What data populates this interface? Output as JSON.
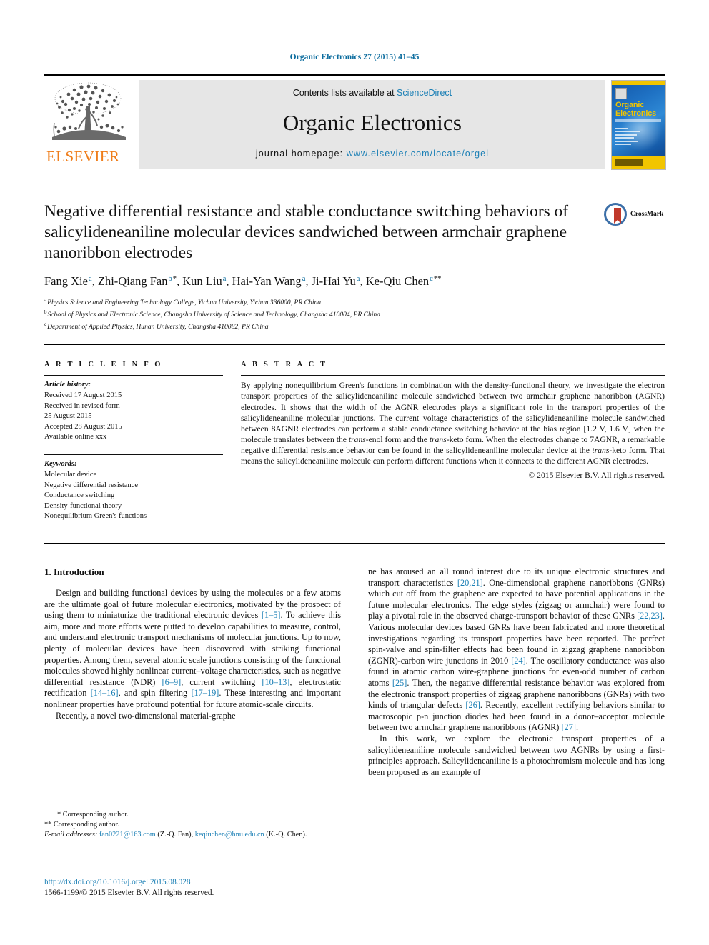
{
  "running_head": "Organic Electronics 27 (2015) 41–45",
  "masthead": {
    "publisher": "ELSEVIER",
    "contents_prefix": "Contents lists available at ",
    "contents_link": "ScienceDirect",
    "journal_name": "Organic Electronics",
    "homepage_label": "journal homepage: ",
    "homepage_url": "www.elsevier.com/locate/orgel",
    "cover_title": "Organic Electronics",
    "accent_blue": "#1a7fb5",
    "accent_orange": "#ef7d1a",
    "cover_yellow": "#f2c500"
  },
  "crossmark": {
    "label": "CrossMark"
  },
  "title": "Negative differential resistance and stable conductance switching behaviors of salicylideneaniline molecular devices sandwiched between armchair graphene nanoribbon electrodes",
  "authors": [
    {
      "name": "Fang Xie",
      "sup": "a",
      "star": ""
    },
    {
      "name": "Zhi-Qiang Fan",
      "sup": "b",
      "star": "*"
    },
    {
      "name": "Kun Liu",
      "sup": "a",
      "star": ""
    },
    {
      "name": "Hai-Yan Wang",
      "sup": "a",
      "star": ""
    },
    {
      "name": "Ji-Hai Yu",
      "sup": "a",
      "star": ""
    },
    {
      "name": "Ke-Qiu Chen",
      "sup": "c",
      "star": "**"
    }
  ],
  "affiliations": [
    {
      "mark": "a",
      "text": "Physics Science and Engineering Technology College, Yichun University, Yichun 336000, PR China"
    },
    {
      "mark": "b",
      "text": "School of Physics and Electronic Science, Changsha University of Science and Technology, Changsha 410004, PR China"
    },
    {
      "mark": "c",
      "text": "Department of Applied Physics, Hunan University, Changsha 410082, PR China"
    }
  ],
  "article_info": {
    "heading": "A R T I C L E    I N F O",
    "history_label": "Article history:",
    "history": [
      "Received 17 August 2015",
      "Received in revised form",
      "25 August 2015",
      "Accepted 28 August 2015",
      "Available online xxx"
    ],
    "keywords_label": "Keywords:",
    "keywords": [
      "Molecular device",
      "Negative differential resistance",
      "Conductance switching",
      "Density-functional theory",
      "Nonequilibrium Green's functions"
    ]
  },
  "abstract": {
    "heading": "A B S T R A C T",
    "body_part1": "By applying nonequilibrium Green's functions in combination with the density-functional theory, we investigate the electron transport properties of the salicylideneaniline molecule sandwiched between two armchair graphene nanoribbon (AGNR) electrodes. It shows that the width of the AGNR electrodes plays a significant role in the transport properties of the salicylideneaniline molecular junctions. The current–voltage characteristics of the salicylideneaniline molecule sandwiched between 8AGNR electrodes can perform a stable conductance switching behavior at the bias region [1.2 V, 1.6 V] when the molecule translates between the ",
    "italic1": "trans",
    "mid1": "-enol form and the ",
    "italic2": "trans",
    "mid2": "-keto form. When the electrodes change to 7AGNR, a remarkable negative differential resistance behavior can be found in the salicylideneaniline molecular device at the ",
    "italic3": "trans",
    "mid3": "-keto form. That means the salicylideneaniline molecule can perform different functions when it connects to the different AGNR electrodes.",
    "copyright": "© 2015 Elsevier B.V. All rights reserved."
  },
  "introduction": {
    "heading": "1. Introduction",
    "p1_a": "Design and building functional devices by using the molecules or a few atoms are the ultimate goal of future molecular electronics, motivated by the prospect of using them to miniaturize the traditional electronic devices ",
    "p1_ref1": "[1–5]",
    "p1_b": ". To achieve this aim, more and more efforts were putted to develop capabilities to measure, control, and understand electronic transport mechanisms of molecular junctions. Up to now, plenty of molecular devices have been discovered with striking functional properties. Among them, several atomic scale junctions consisting of the functional molecules showed highly nonlinear current–voltage characteristics, such as negative differential resistance (NDR) ",
    "p1_ref2": "[6–9]",
    "p1_c": ", current switching ",
    "p1_ref3": "[10–13]",
    "p1_d": ", electrostatic rectification ",
    "p1_ref4": "[14–16]",
    "p1_e": ", and spin filtering ",
    "p1_ref5": "[17–19]",
    "p1_f": ". These interesting and important nonlinear properties have profound potential for future atomic-scale circuits.",
    "p2_a": "Recently, a novel two-dimensional material-graphene has aroused an all round interest due to its unique electronic structures and transport characteristics ",
    "p2_ref1": "[20,21]",
    "p2_b": ". One-dimensional graphene nanoribbons (GNRs) which cut off from the graphene are expected to have potential applications in the future molecular electronics. The edge styles (zigzag or armchair) were found to play a pivotal role in the observed charge-transport behavior of these GNRs ",
    "p2_ref2": "[22,23]",
    "p2_c": ". Various molecular devices based GNRs have been fabricated and more theoretical investigations regarding its transport properties have been reported. The perfect spin-valve and spin-filter effects had been found in zigzag graphene nanoribbon (ZGNR)-carbon wire junctions in 2010 ",
    "p2_ref3": "[24]",
    "p2_d": ". The oscillatory conductance was also found in atomic carbon wire-graphene junctions for even-odd number of carbon atoms ",
    "p2_ref4": "[25]",
    "p2_e": ". Then, the negative differential resistance behavior was explored from the electronic transport properties of zigzag graphene nanoribbons (GNRs) with two kinds of triangular defects ",
    "p2_ref5": "[26]",
    "p2_f": ". Recently, excellent rectifying behaviors similar to macroscopic p-n junction diodes had been found in a donor–acceptor molecule between two armchair graphene nanoribbons (AGNR) ",
    "p2_ref6": "[27]",
    "p2_g": ".",
    "p3_a": "In this work, we explore the electronic transport properties of a salicylideneaniline molecule sandwiched between two AGNRs by using a first-principles approach. Salicylideneaniline is a photochromism molecule and has long been proposed as an example of"
  },
  "footnotes": {
    "corr1": "* Corresponding author.",
    "corr2": "** Corresponding author.",
    "email_label": "E-mail addresses:",
    "email1": "fan0221@163.com",
    "email1_who": "(Z.-Q. Fan),",
    "email2": "keqiuchen@hnu.edu.cn",
    "email2_who": "(K.-Q. Chen)."
  },
  "doi": {
    "url": "http://dx.doi.org/10.1016/j.orgel.2015.08.028",
    "issn_line": "1566-1199/© 2015 Elsevier B.V. All rights reserved."
  }
}
